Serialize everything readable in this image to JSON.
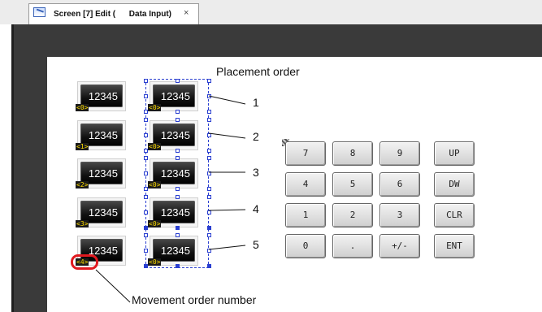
{
  "tab": {
    "title": "Screen [7] Edit (      Data Input)",
    "close": "×",
    "icon": "screen-edit-icon"
  },
  "left_column": [
    {
      "value": "12345",
      "order": "<0>"
    },
    {
      "value": "12345",
      "order": "<1>"
    },
    {
      "value": "12345",
      "order": "<2>"
    },
    {
      "value": "12345",
      "order": "<3>"
    },
    {
      "value": "12345",
      "order": "<4>"
    }
  ],
  "right_column": [
    {
      "value": "12345",
      "order": "<0>"
    },
    {
      "value": "12345",
      "order": "<0>"
    },
    {
      "value": "12345",
      "order": "<0>"
    },
    {
      "value": "12345",
      "order": "<0>"
    },
    {
      "value": "12345",
      "order": "<0>"
    }
  ],
  "keypad": [
    [
      "7",
      "8",
      "9",
      "UP"
    ],
    [
      "4",
      "5",
      "6",
      "DW"
    ],
    [
      "1",
      "2",
      "3",
      "CLR"
    ],
    [
      "0",
      ".",
      "+/-",
      "ENT"
    ]
  ],
  "annotations": {
    "placement_title": "Placement order",
    "placement_numbers": [
      "1",
      "2",
      "3",
      "4",
      "5"
    ],
    "movement_label": "Movement order number"
  },
  "colors": {
    "selection": "#2a3fd0",
    "highlight_ring": "#e0191f",
    "order_label": "#ffde00"
  }
}
